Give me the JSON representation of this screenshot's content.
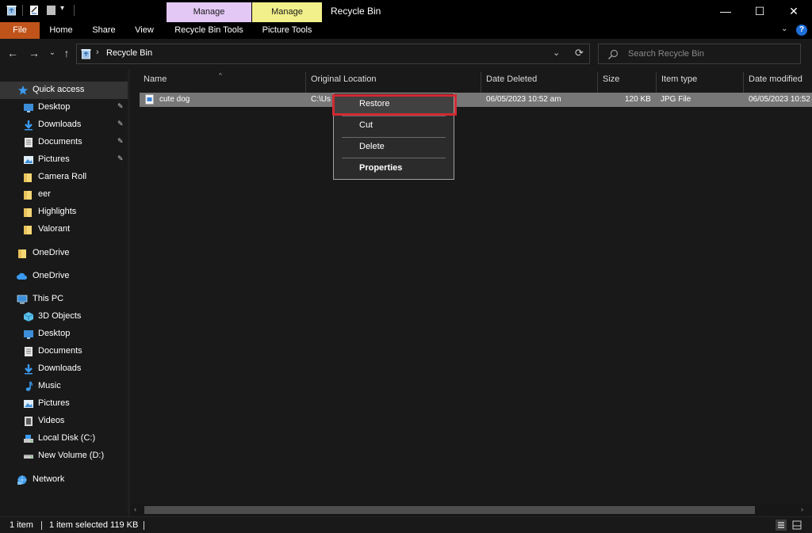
{
  "window": {
    "title": "Recycle Bin",
    "context_tabs": [
      {
        "label": "Manage",
        "color": "#e3c8f5"
      },
      {
        "label": "Manage",
        "color": "#f2f08a"
      }
    ],
    "minimize_glyph": "—",
    "maximize_glyph": "☐",
    "close_glyph": "✕"
  },
  "ribbon": {
    "tabs": [
      "File",
      "Home",
      "Share",
      "View",
      "Recycle Bin Tools",
      "Picture Tools"
    ],
    "file_color": "#c0531a",
    "chevron_glyph": "⌄",
    "help_glyph": "?"
  },
  "address": {
    "back_glyph": "←",
    "forward_glyph": "→",
    "recent_glyph": "⌄",
    "up_glyph": "↑",
    "crumb_sep": "›",
    "path": "Recycle Bin",
    "dropdown_glyph": "⌄",
    "refresh_glyph": "⟳",
    "search_placeholder": "Search Recycle Bin"
  },
  "sidebar": {
    "quick_access": "Quick access",
    "quick_items": [
      {
        "label": "Desktop",
        "icon": "desktop-icon",
        "pinned": true
      },
      {
        "label": "Downloads",
        "icon": "downloads-icon",
        "pinned": true
      },
      {
        "label": "Documents",
        "icon": "documents-icon",
        "pinned": true
      },
      {
        "label": "Pictures",
        "icon": "pictures-icon",
        "pinned": true
      },
      {
        "label": "Camera Roll",
        "icon": "folder-icon",
        "pinned": false
      },
      {
        "label": "eer",
        "icon": "folder-icon",
        "pinned": false
      },
      {
        "label": "Highlights",
        "icon": "folder-icon",
        "pinned": false
      },
      {
        "label": "Valorant",
        "icon": "folder-icon",
        "pinned": false
      }
    ],
    "pin_glyph": "📌",
    "onedrive_1": "OneDrive",
    "onedrive_2": "OneDrive",
    "this_pc": "This PC",
    "pc_items": [
      {
        "label": "3D Objects",
        "icon": "3d-objects-icon"
      },
      {
        "label": "Desktop",
        "icon": "desktop-icon"
      },
      {
        "label": "Documents",
        "icon": "documents-icon"
      },
      {
        "label": "Downloads",
        "icon": "downloads-icon"
      },
      {
        "label": "Music",
        "icon": "music-icon"
      },
      {
        "label": "Pictures",
        "icon": "pictures-icon"
      },
      {
        "label": "Videos",
        "icon": "videos-icon"
      },
      {
        "label": "Local Disk (C:)",
        "icon": "local-disk-icon"
      },
      {
        "label": "New Volume (D:)",
        "icon": "drive-icon"
      }
    ],
    "network": "Network"
  },
  "columns": [
    "Name",
    "Original Location",
    "Date Deleted",
    "Size",
    "Item type",
    "Date modified"
  ],
  "sort_glyph": "^",
  "files": [
    {
      "name": "cute dog",
      "original_location": "C:\\Us",
      "date_deleted": "06/05/2023 10:52 am",
      "size": "120 KB",
      "item_type": "JPG File",
      "date_modified": "06/05/2023 10:52"
    }
  ],
  "context_menu": {
    "items": [
      "Restore",
      "Cut",
      "Delete",
      "Properties"
    ]
  },
  "hscroll": {
    "left_glyph": "‹",
    "right_glyph": "›"
  },
  "status": {
    "count": "1 item",
    "selected": "1 item selected  119 KB"
  }
}
